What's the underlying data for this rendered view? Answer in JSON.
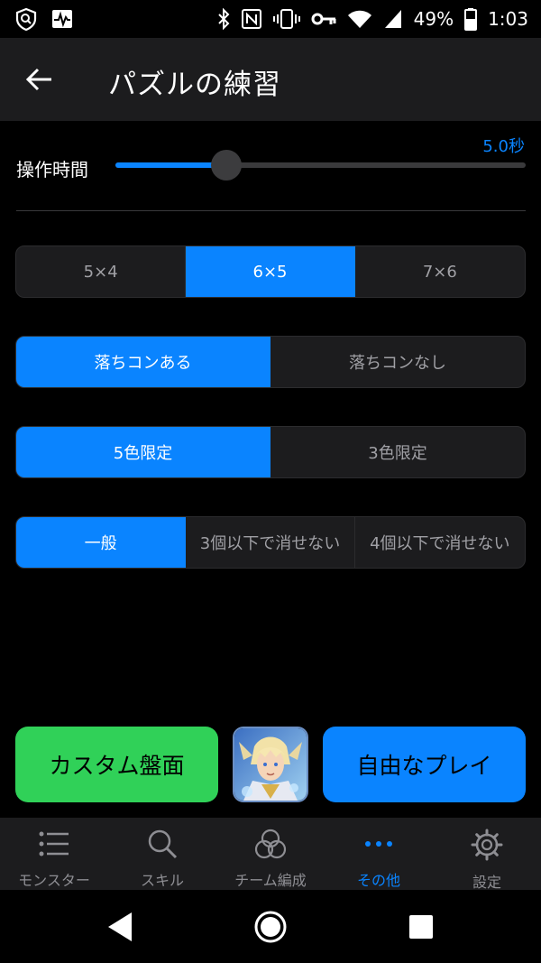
{
  "status_bar": {
    "battery_percent": "49%",
    "time": "1:03",
    "left_icons": [
      "shield-search-icon",
      "pulse-monitor-icon"
    ],
    "right_icons": [
      "bluetooth-icon",
      "nfc-icon",
      "vibrate-icon",
      "vpn-key-icon",
      "wifi-icon",
      "cell-signal-icon",
      "battery-icon"
    ]
  },
  "app_bar": {
    "title": "パズルの練習",
    "back_icon": "arrow-left-icon"
  },
  "slider": {
    "label": "操作時間",
    "value_text": "5.0秒",
    "fill_fraction": 0.27
  },
  "segments": {
    "board_size": {
      "options": [
        "5×4",
        "6×5",
        "7×6"
      ],
      "selected_index": 1
    },
    "combo_drop": {
      "options": [
        "落ちコンある",
        "落ちコンなし"
      ],
      "selected_index": 0
    },
    "color_limit": {
      "options": [
        "5色限定",
        "3色限定"
      ],
      "selected_index": 0
    },
    "erase_rule": {
      "options": [
        "一般",
        "3個以下で消せない",
        "4個以下で消せない"
      ],
      "selected_index": 0
    }
  },
  "actions": {
    "custom_board": "カスタム盤面",
    "free_play": "自由なプレイ"
  },
  "tabs": [
    {
      "label": "モンスター",
      "icon": "list-icon",
      "active": false
    },
    {
      "label": "スキル",
      "icon": "search-icon",
      "active": false
    },
    {
      "label": "チーム編成",
      "icon": "three-circles-icon",
      "active": false
    },
    {
      "label": "その他",
      "icon": "more-dots-icon",
      "active": true
    },
    {
      "label": "設定",
      "icon": "gear-icon",
      "active": false
    }
  ],
  "colors": {
    "accent": "#0a84ff",
    "green": "#30d158",
    "surface": "#1c1c1e",
    "background": "#000000"
  }
}
